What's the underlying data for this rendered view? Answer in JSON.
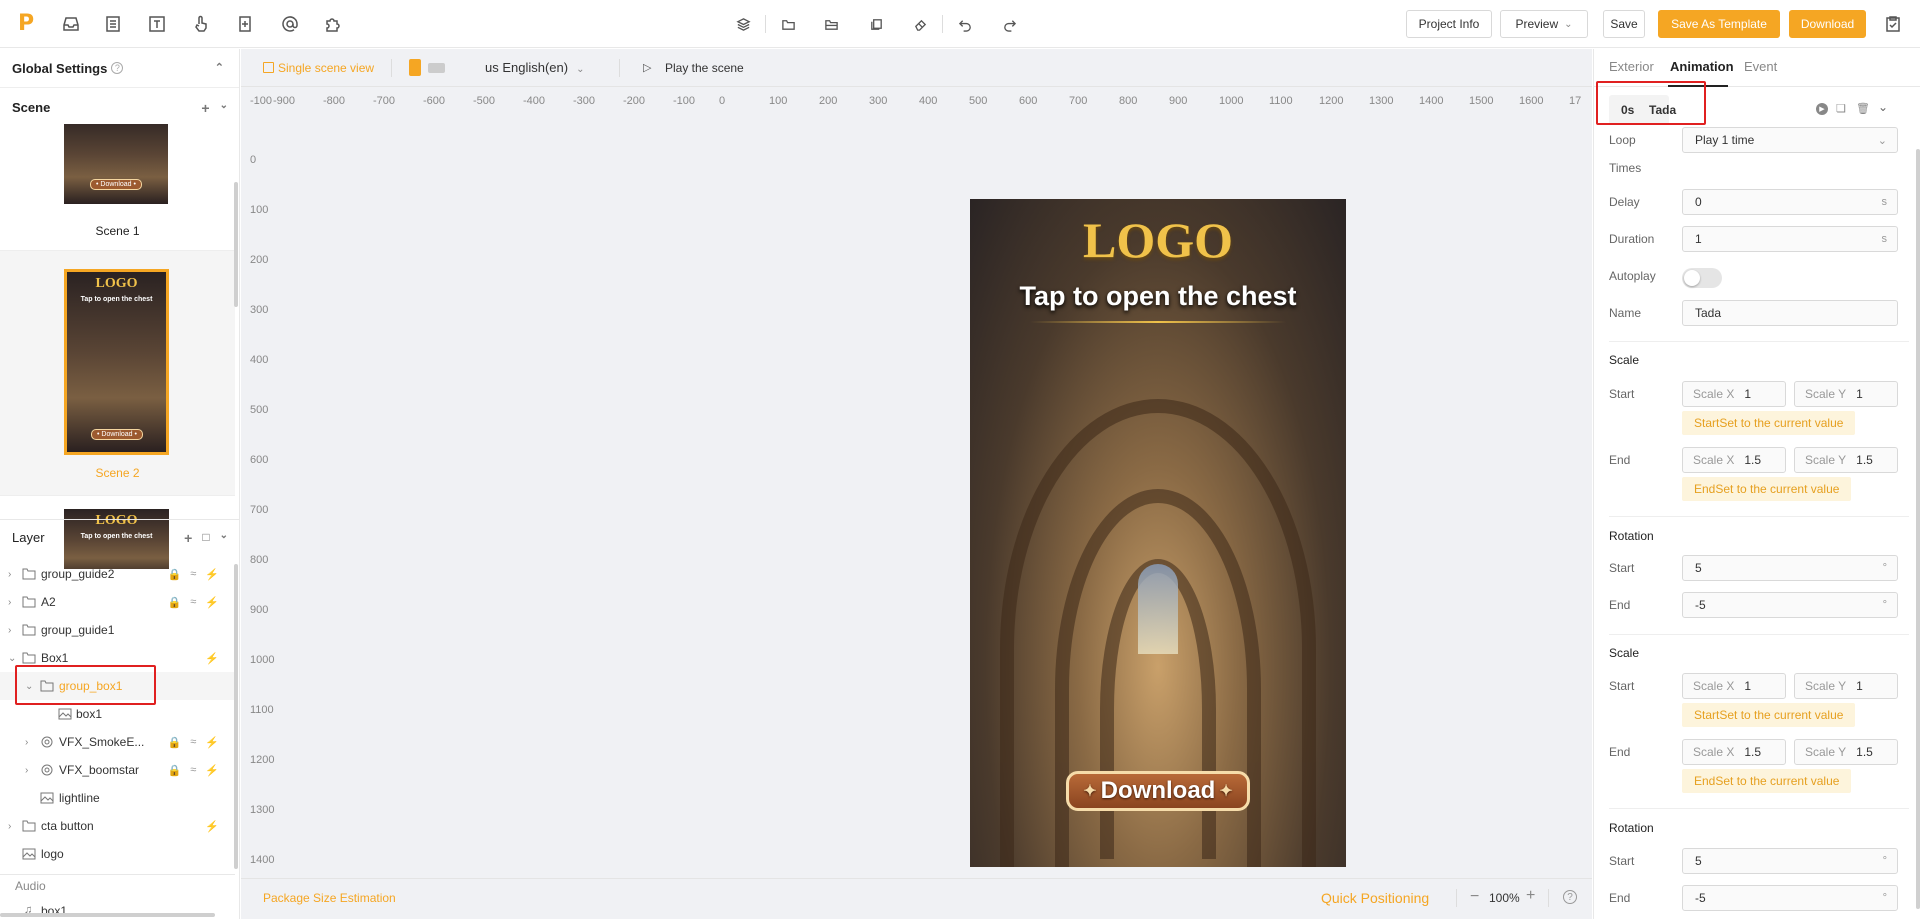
{
  "topbar": {
    "center_tools": [
      "layers-icon",
      "folder-icon",
      "folder-open-icon",
      "copy-icon",
      "eraser-icon",
      "undo-icon",
      "redo-icon"
    ],
    "project_info": "Project Info",
    "preview": "Preview",
    "save": "Save",
    "save_template": "Save As Template",
    "download": "Download"
  },
  "left": {
    "global_settings": "Global Settings",
    "scene_title": "Scene",
    "scenes": [
      {
        "label": "Scene 1",
        "thumb_logo": "",
        "thumb_tap": "",
        "thumb_btn": "• Download •"
      },
      {
        "label": "Scene 2",
        "thumb_logo": "LOGO",
        "thumb_tap": "Tap to open the chest",
        "thumb_btn": "• Download •"
      },
      {
        "label": "",
        "thumb_logo": "LOGO",
        "thumb_tap": "Tap to open the chest",
        "thumb_btn": ""
      }
    ],
    "layer_title": "Layer",
    "layers": [
      {
        "name": "group_guide2"
      },
      {
        "name": "A2"
      },
      {
        "name": "group_guide1"
      },
      {
        "name": "Box1"
      },
      {
        "name": "group_box1"
      },
      {
        "name": "box1"
      },
      {
        "name": "VFX_SmokeE..."
      },
      {
        "name": "VFX_boomstar"
      },
      {
        "name": "lightline"
      },
      {
        "name": "cta button"
      },
      {
        "name": "logo"
      }
    ],
    "audio_title": "Audio",
    "audio_item": "box1"
  },
  "canvas": {
    "single_scene": "Single scene view",
    "language": "us English(en)",
    "play_scene": "Play the scene",
    "ruler_x": [
      "-100",
      "-900",
      "-800",
      "-700",
      "-600",
      "-500",
      "-400",
      "-300",
      "-200",
      "-100",
      "0",
      "100",
      "200",
      "300",
      "400",
      "500",
      "600",
      "700",
      "800",
      "900",
      "1000",
      "1100",
      "1200",
      "1300",
      "1400",
      "1500",
      "1600",
      "17"
    ],
    "ruler_y": [
      "0",
      "100",
      "200",
      "300",
      "400",
      "500",
      "600",
      "700",
      "800",
      "900",
      "1000",
      "1100",
      "1200",
      "1300",
      "1400"
    ],
    "stage": {
      "logo": "LOGO",
      "tap": "Tap to open the chest",
      "button": "Download"
    },
    "package_size": "Package Size Estimation",
    "quick_positioning": "Quick Positioning",
    "zoom": "100%"
  },
  "right": {
    "tabs": [
      "Exterior",
      "Animation",
      "Event"
    ],
    "anim_time": "0s",
    "anim_name_tag": "Tada",
    "loop_label": "Loop",
    "times_label": "Times",
    "loop_value": "Play 1 time",
    "delay_label": "Delay",
    "delay_value": "0",
    "duration_label": "Duration",
    "duration_value": "1",
    "unit_s": "s",
    "autoplay_label": "Autoplay",
    "name_label": "Name",
    "name_value": "Tada",
    "scale_title": "Scale",
    "start_label": "Start",
    "end_label": "End",
    "scale_x_label": "Scale X",
    "scale_y_label": "Scale Y",
    "scale_start_x": "1",
    "scale_start_y": "1",
    "scale_end_x": "1.5",
    "scale_end_y": "1.5",
    "start_set": "StartSet to the current value",
    "end_set": "EndSet to the current value",
    "rotation_title": "Rotation",
    "rot_start": "5",
    "rot_end": "-5",
    "deg": "°"
  }
}
